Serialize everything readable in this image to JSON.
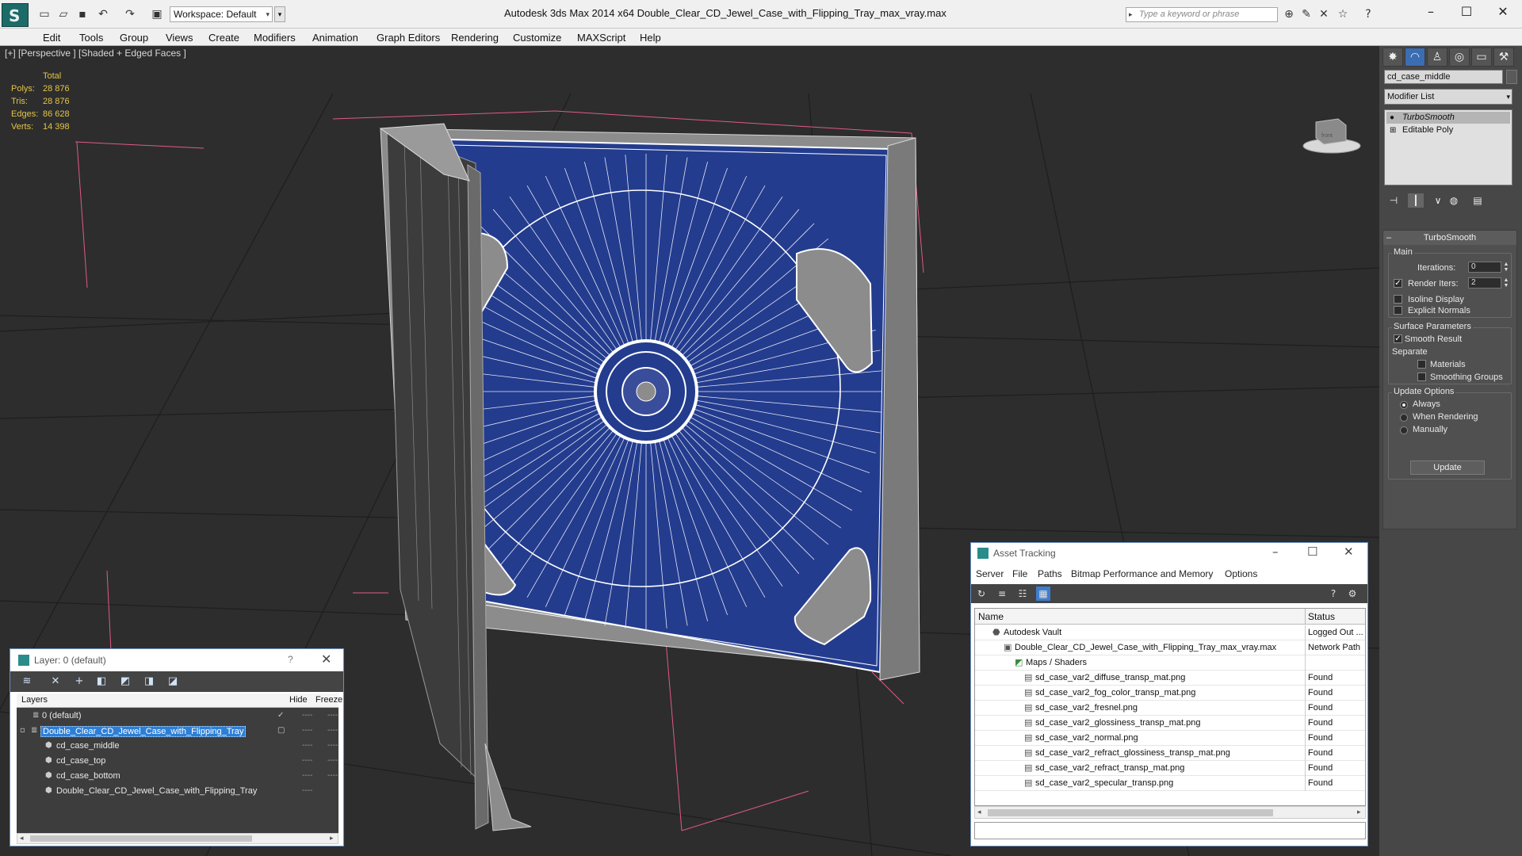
{
  "titlebar": {
    "workspace": "Workspace: Default",
    "title": "Autodesk 3ds Max  2014 x64      Double_Clear_CD_Jewel_Case_with_Flipping_Tray_max_vray.max",
    "search_placeholder": "Type a keyword or phrase"
  },
  "menu": [
    "Edit",
    "Tools",
    "Group",
    "Views",
    "Create",
    "Modifiers",
    "Animation",
    "Graph Editors",
    "Rendering",
    "Customize",
    "MAXScript",
    "Help"
  ],
  "viewport": {
    "label": "[+] [Perspective ] [Shaded + Edged Faces ]",
    "stats": {
      "header": "Total",
      "rows": [
        {
          "k": "Polys:",
          "v": "28 876"
        },
        {
          "k": "Tris:",
          "v": "28 876"
        },
        {
          "k": "Edges:",
          "v": "86 628"
        },
        {
          "k": "Verts:",
          "v": "14 398"
        }
      ]
    },
    "colors": {
      "disc": "#233c8e",
      "frame": "#8c8c8c",
      "bg": "#2d2d2d",
      "wire": "#ffffff",
      "pink": "#e05a86"
    }
  },
  "command_panel": {
    "object_name": "cd_case_middle",
    "modifier_list": "Modifier List",
    "stack": [
      "TurboSmooth",
      "Editable Poly"
    ],
    "rollout": {
      "title": "TurboSmooth",
      "main_label": "Main",
      "iterations_label": "Iterations:",
      "iterations": "0",
      "render_iters_label": "Render Iters:",
      "render_iters": "2",
      "isoline": "Isoline Display",
      "explicit_normals": "Explicit Normals",
      "surface_params": "Surface Parameters",
      "smooth_result": "Smooth Result",
      "separate": "Separate",
      "materials": "Materials",
      "smoothing_groups": "Smoothing Groups",
      "update_options": "Update Options",
      "always": "Always",
      "when_rendering": "When Rendering",
      "manually": "Manually",
      "update_button": "Update"
    }
  },
  "layer_dialog": {
    "title": "Layer: 0 (default)",
    "help": "?",
    "col_layers": "Layers",
    "col_hide": "Hide",
    "col_freeze": "Freeze",
    "rows": [
      {
        "name": "0 (default)",
        "indent": 0
      },
      {
        "name": "Double_Clear_CD_Jewel_Case_with_Flipping_Tray",
        "indent": 0
      },
      {
        "name": "cd_case_middle",
        "indent": 1
      },
      {
        "name": "cd_case_top",
        "indent": 1
      },
      {
        "name": "cd_case_bottom",
        "indent": 1
      },
      {
        "name": "Double_Clear_CD_Jewel_Case_with_Flipping_Tray",
        "indent": 1
      }
    ]
  },
  "asset_dialog": {
    "title": "Asset Tracking",
    "menu": [
      "Server",
      "File",
      "Paths",
      "Bitmap Performance and Memory",
      "Options"
    ],
    "col_name": "Name",
    "col_status": "Status",
    "rows": [
      {
        "name": "Autodesk Vault",
        "status": "Logged Out ...",
        "indent": 1
      },
      {
        "name": "Double_Clear_CD_Jewel_Case_with_Flipping_Tray_max_vray.max",
        "status": "Network Path",
        "indent": 2
      },
      {
        "name": "Maps / Shaders",
        "status": "",
        "indent": 3
      },
      {
        "name": "sd_case_var2_diffuse_transp_mat.png",
        "status": "Found",
        "indent": 4
      },
      {
        "name": "sd_case_var2_fog_color_transp_mat.png",
        "status": "Found",
        "indent": 4
      },
      {
        "name": "sd_case_var2_fresnel.png",
        "status": "Found",
        "indent": 4
      },
      {
        "name": "sd_case_var2_glossiness_transp_mat.png",
        "status": "Found",
        "indent": 4
      },
      {
        "name": "sd_case_var2_normal.png",
        "status": "Found",
        "indent": 4
      },
      {
        "name": "sd_case_var2_refract_glossiness_transp_mat.png",
        "status": "Found",
        "indent": 4
      },
      {
        "name": "sd_case_var2_refract_transp_mat.png",
        "status": "Found",
        "indent": 4
      },
      {
        "name": "sd_case_var2_specular_transp.png",
        "status": "Found",
        "indent": 4
      }
    ]
  }
}
